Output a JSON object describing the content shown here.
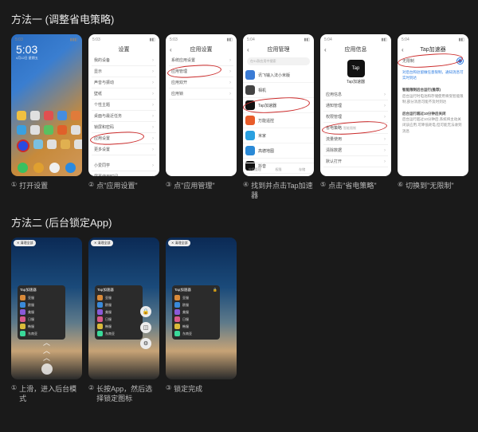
{
  "method1": {
    "title": "方法一 (调整省电策略)",
    "steps": [
      {
        "n": "①",
        "label": "打开设置"
      },
      {
        "n": "②",
        "label": "点\"应用设置\""
      },
      {
        "n": "③",
        "label": "点\"应用管理\""
      },
      {
        "n": "④",
        "label": "找到并点击Tap加速器"
      },
      {
        "n": "⑤",
        "label": "点击\"省电策略\""
      },
      {
        "n": "⑥",
        "label": "切换到\"无限制\""
      }
    ]
  },
  "method2": {
    "title": "方法二 (后台锁定App)",
    "steps": [
      {
        "n": "①",
        "label": "上滑，进入后台模式"
      },
      {
        "n": "②",
        "label": "长按App，然后选择锁定图标"
      },
      {
        "n": "③",
        "label": "锁定完成"
      }
    ]
  },
  "home": {
    "time": "5:03",
    "date": "4月12日 星期五"
  },
  "settings": {
    "title": "设置",
    "items": [
      "我的设备",
      "显示",
      "声音与振动",
      "壁纸",
      "个性主题",
      "桌面与最近任务",
      "锁屏和密码",
      "应用设置",
      "更多设置",
      "",
      "小爱同学",
      "屏幕使用时间"
    ]
  },
  "appset": {
    "title": "应用设置",
    "items": [
      "系统应用设置",
      "应用管理",
      "应用双开",
      "应用锁"
    ]
  },
  "appmgr": {
    "title": "应用管理",
    "search": "在91款应用中搜索",
    "apps": [
      {
        "name": "讯飞输入法小米版",
        "c": "#3a7bd5"
      },
      {
        "name": "相机",
        "c": "#444"
      },
      {
        "name": "Tap加速器",
        "c": "#111"
      },
      {
        "name": "万能遥控",
        "c": "#e85c2a"
      },
      {
        "name": "米家",
        "c": "#2aa0e0"
      },
      {
        "name": "高德地图",
        "c": "#2a89d6"
      },
      {
        "name": "抖音",
        "c": "#111"
      }
    ],
    "tabs": [
      "应用管理",
      "权限",
      "存储"
    ]
  },
  "tapcfg": {
    "title": "应用信息",
    "name": "Tap加速器",
    "items": [
      "应用信息",
      "通知管理",
      "权限管理",
      "省电策略",
      "流量使用",
      "清除数据",
      "默认打开"
    ]
  },
  "tapdet": {
    "title": "Tap加速器",
    "opt0": "无限制",
    "desc0": "对后台和驻留做任意限制，通知消息可实时到达",
    "hdr1": "智能限制后台运行(推荐)",
    "desc1": "后台运行时电池和存储使用将受智能限制,部分消息可能不及时到达",
    "hdr2": "后台运行超过10分钟后关闭",
    "desc2": "后台运行超过10分钟后,系统将主动关闭该应用,可降低耗电,但可能无法收到消息"
  },
  "recents": {
    "pill": "✕ 清理全部",
    "app": "Tap加速器",
    "rows": [
      "亚服",
      "欧服",
      "美服",
      "日服",
      "韩服",
      "东南亚"
    ]
  }
}
